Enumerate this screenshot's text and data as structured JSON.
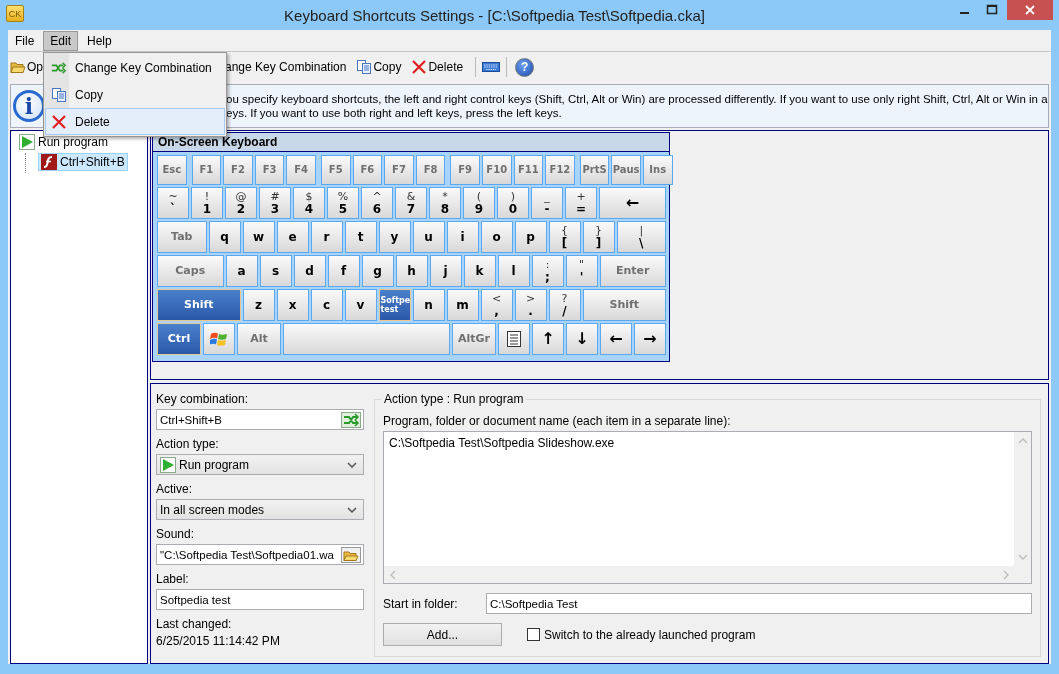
{
  "window": {
    "title": "Keyboard Shortcuts Settings - [C:\\Softpedia Test\\Softpedia.cka]",
    "app_icon": "CK"
  },
  "menu": [
    {
      "label": "File",
      "selected": false
    },
    {
      "label": "Edit",
      "selected": true
    },
    {
      "label": "Help",
      "selected": false
    }
  ],
  "edit_menu": [
    {
      "label": "Change Key Combination",
      "kind": "change",
      "selected": false
    },
    {
      "label": "Copy",
      "kind": "copy",
      "selected": false
    },
    {
      "label": "Delete",
      "kind": "delete",
      "selected": true
    }
  ],
  "toolbar": [
    {
      "label": "Op",
      "kind": "open"
    },
    {
      "label": "ange Key Combination",
      "kind": "change"
    },
    {
      "label": "Copy",
      "kind": "copy"
    },
    {
      "label": "Delete",
      "kind": "delete"
    },
    {
      "kind": "keyboard"
    },
    {
      "label": "?",
      "kind": "help"
    }
  ],
  "info": {
    "icon_glyph": "i",
    "lines": [
      "ou specify keyboard shortcuts, the left and right control keys (Shift, Ctrl, Alt or Win) are processed differently. If you want to use only right Shift, Ctrl, Alt or Win in a",
      "eys. If you want to use both right and left keys, press the left keys."
    ]
  },
  "tree": [
    {
      "label": "Run program",
      "kind": "run",
      "selected": false,
      "children": [
        {
          "label": "Ctrl+Shift+B",
          "kind": "flash",
          "selected": true
        }
      ]
    }
  ],
  "keyboard": {
    "title": "On-Screen Keyboard",
    "rows": [
      [
        [
          {
            "main": "Esc",
            "kind": "fn",
            "pressed": false
          }
        ],
        [
          {
            "main": "F1",
            "kind": "fn",
            "pressed": false
          },
          {
            "main": "F2",
            "kind": "fn",
            "pressed": false
          },
          {
            "main": "F3",
            "kind": "fn",
            "pressed": false
          },
          {
            "main": "F4",
            "kind": "fn",
            "pressed": false
          }
        ],
        [
          {
            "main": "F5",
            "kind": "fn",
            "pressed": false
          },
          {
            "main": "F6",
            "kind": "fn",
            "pressed": false
          },
          {
            "main": "F7",
            "kind": "fn",
            "pressed": false
          },
          {
            "main": "F8",
            "kind": "fn",
            "pressed": false
          }
        ],
        [
          {
            "main": "F9",
            "kind": "fn",
            "pressed": false
          },
          {
            "main": "F10",
            "kind": "fn",
            "pressed": false
          },
          {
            "main": "F11",
            "kind": "fn",
            "pressed": false
          },
          {
            "main": "F12",
            "kind": "fn",
            "pressed": false
          }
        ],
        [
          {
            "main": "PrtS",
            "kind": "fn",
            "pressed": false
          },
          {
            "main": "Paus",
            "kind": "fn",
            "pressed": false
          },
          {
            "main": "Ins",
            "kind": "fn",
            "pressed": false
          }
        ]
      ],
      [
        [
          {
            "main": "`",
            "shift": "~",
            "kind": "char",
            "pressed": false
          },
          {
            "main": "1",
            "shift": "!",
            "kind": "char",
            "pressed": false
          },
          {
            "main": "2",
            "shift": "@",
            "kind": "char",
            "pressed": false
          },
          {
            "main": "3",
            "shift": "#",
            "kind": "char",
            "pressed": false
          },
          {
            "main": "4",
            "shift": "$",
            "kind": "char",
            "pressed": false
          },
          {
            "main": "5",
            "shift": "%",
            "kind": "char",
            "pressed": false
          },
          {
            "main": "6",
            "shift": "^",
            "kind": "char",
            "pressed": false
          },
          {
            "main": "7",
            "shift": "&",
            "kind": "char",
            "pressed": false
          },
          {
            "main": "8",
            "shift": "*",
            "kind": "char",
            "pressed": false
          },
          {
            "main": "9",
            "shift": "(",
            "kind": "char",
            "pressed": false
          },
          {
            "main": "0",
            "shift": ")",
            "kind": "char",
            "pressed": false
          },
          {
            "main": "-",
            "shift": "_",
            "kind": "char",
            "pressed": false
          },
          {
            "main": "=",
            "shift": "+",
            "kind": "char",
            "pressed": false
          },
          {
            "main": "←",
            "kind": "glyph-wide",
            "pressed": false
          }
        ]
      ],
      [
        [
          {
            "main": "Tab",
            "kind": "fn-wide",
            "pressed": false
          },
          {
            "main": "q",
            "kind": "char",
            "pressed": false
          },
          {
            "main": "w",
            "kind": "char",
            "pressed": false
          },
          {
            "main": "e",
            "kind": "char",
            "pressed": false
          },
          {
            "main": "r",
            "kind": "char",
            "pressed": false
          },
          {
            "main": "t",
            "kind": "char",
            "pressed": false
          },
          {
            "main": "y",
            "kind": "char",
            "pressed": false
          },
          {
            "main": "u",
            "kind": "char",
            "pressed": false
          },
          {
            "main": "i",
            "kind": "char",
            "pressed": false
          },
          {
            "main": "o",
            "kind": "char",
            "pressed": false
          },
          {
            "main": "p",
            "kind": "char",
            "pressed": false
          },
          {
            "main": "[",
            "shift": "{",
            "kind": "char",
            "pressed": false
          },
          {
            "main": "]",
            "shift": "}",
            "kind": "char",
            "pressed": false
          },
          {
            "main": "\\",
            "shift": "|",
            "kind": "char-wide",
            "pressed": false
          }
        ]
      ],
      [
        [
          {
            "main": "Caps",
            "kind": "fn-wide",
            "pressed": false
          },
          {
            "main": "a",
            "kind": "char",
            "pressed": false
          },
          {
            "main": "s",
            "kind": "char",
            "pressed": false
          },
          {
            "main": "d",
            "kind": "char",
            "pressed": false
          },
          {
            "main": "f",
            "kind": "char",
            "pressed": false
          },
          {
            "main": "g",
            "kind": "char",
            "pressed": false
          },
          {
            "main": "h",
            "kind": "char",
            "pressed": false
          },
          {
            "main": "j",
            "kind": "char",
            "pressed": false
          },
          {
            "main": "k",
            "kind": "char",
            "pressed": false
          },
          {
            "main": "l",
            "kind": "char",
            "pressed": false
          },
          {
            "main": ";",
            "shift": ":",
            "kind": "char",
            "pressed": false
          },
          {
            "main": "'",
            "shift": "\"",
            "kind": "char",
            "pressed": false
          },
          {
            "main": "Enter",
            "kind": "fn-wide",
            "pressed": false
          }
        ]
      ],
      [
        [
          {
            "main": "Shift",
            "kind": "fn-wide",
            "pressed": true
          },
          {
            "main": "z",
            "kind": "char",
            "pressed": false
          },
          {
            "main": "x",
            "kind": "char",
            "pressed": false
          },
          {
            "main": "c",
            "kind": "char",
            "pressed": false
          },
          {
            "main": "v",
            "kind": "char",
            "pressed": false
          },
          {
            "main": "Softpe test",
            "kind": "caption",
            "pressed": true
          },
          {
            "main": "n",
            "kind": "char",
            "pressed": false
          },
          {
            "main": "m",
            "kind": "char",
            "pressed": false
          },
          {
            "main": ",",
            "shift": "<",
            "kind": "char",
            "pressed": false
          },
          {
            "main": ".",
            "shift": ">",
            "kind": "char",
            "pressed": false
          },
          {
            "main": "/",
            "shift": "?",
            "kind": "char",
            "pressed": false
          },
          {
            "main": "Shift",
            "kind": "fn-wide",
            "pressed": false
          }
        ]
      ],
      [
        [
          {
            "main": "Ctrl",
            "kind": "mod",
            "pressed": true
          },
          {
            "kind": "windows",
            "pressed": false
          },
          {
            "main": "Alt",
            "kind": "mod",
            "pressed": false
          },
          {
            "kind": "space",
            "pressed": false
          },
          {
            "main": "AltGr",
            "kind": "mod",
            "pressed": false
          },
          {
            "kind": "menu",
            "pressed": false
          },
          {
            "main": "↑",
            "kind": "glyph",
            "pressed": false
          },
          {
            "main": "↓",
            "kind": "glyph",
            "pressed": false
          },
          {
            "main": "←",
            "kind": "glyph",
            "pressed": false
          },
          {
            "main": "→",
            "kind": "glyph",
            "pressed": false
          }
        ]
      ]
    ]
  },
  "form": {
    "key_combination": {
      "label": "Key combination:",
      "value": "Ctrl+Shift+B"
    },
    "action_type": {
      "label": "Action type:",
      "value": "Run program"
    },
    "active": {
      "label": "Active:",
      "value": "In all screen modes"
    },
    "sound": {
      "label": "Sound:",
      "value": "\"C:\\Softpedia Test\\Softpedia01.wa"
    },
    "label": {
      "label": "Label:",
      "value": "Softpedia test"
    },
    "last_changed": {
      "label": "Last changed:",
      "value": "6/25/2015 11:14:42 PM"
    }
  },
  "action_group": {
    "title": "Action type : Run program",
    "program_label": "Program, folder or document name (each item in a separate line):",
    "program_value": "C:\\Softpedia Test\\Softpedia Slideshow.exe",
    "start_label": "Start in folder:",
    "start_value": "C:\\Softpedia Test",
    "add_button": "Add...",
    "switch_checkbox": {
      "label": "Switch to the already launched program",
      "checked": false
    }
  }
}
